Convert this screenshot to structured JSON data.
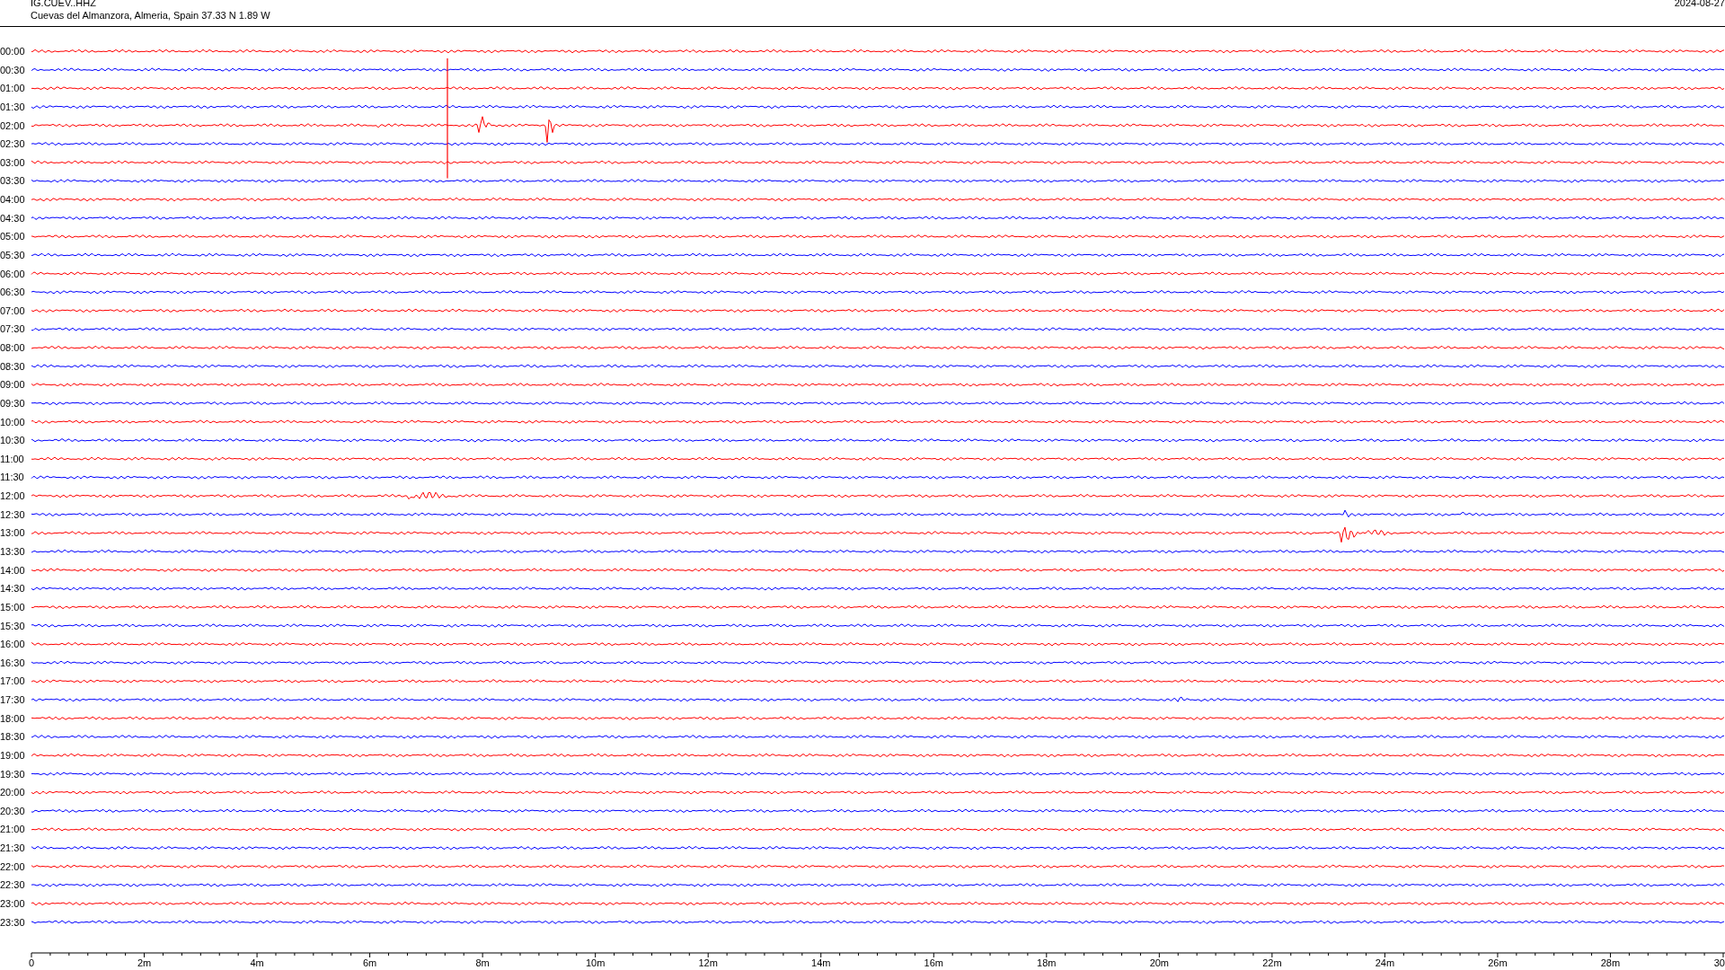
{
  "header": {
    "channel": "IG.CUEV..HHZ",
    "location": "Cuevas del Almanzora, Almeria, Spain  37.33 N 1.89 W",
    "date": "2024-08-27"
  },
  "rows": [
    {
      "time": "00:00",
      "color": "#ff0000"
    },
    {
      "time": "00:30",
      "color": "#0000ff"
    },
    {
      "time": "01:00",
      "color": "#ff0000"
    },
    {
      "time": "01:30",
      "color": "#0000ff"
    },
    {
      "time": "02:00",
      "color": "#ff0000"
    },
    {
      "time": "02:30",
      "color": "#0000ff"
    },
    {
      "time": "03:00",
      "color": "#ff0000"
    },
    {
      "time": "03:30",
      "color": "#0000ff"
    },
    {
      "time": "04:00",
      "color": "#ff0000"
    },
    {
      "time": "04:30",
      "color": "#0000ff"
    },
    {
      "time": "05:00",
      "color": "#ff0000"
    },
    {
      "time": "05:30",
      "color": "#0000ff"
    },
    {
      "time": "06:00",
      "color": "#ff0000"
    },
    {
      "time": "06:30",
      "color": "#0000ff"
    },
    {
      "time": "07:00",
      "color": "#ff0000"
    },
    {
      "time": "07:30",
      "color": "#0000ff"
    },
    {
      "time": "08:00",
      "color": "#ff0000"
    },
    {
      "time": "08:30",
      "color": "#0000ff"
    },
    {
      "time": "09:00",
      "color": "#ff0000"
    },
    {
      "time": "09:30",
      "color": "#0000ff"
    },
    {
      "time": "10:00",
      "color": "#ff0000"
    },
    {
      "time": "10:30",
      "color": "#0000ff"
    },
    {
      "time": "11:00",
      "color": "#ff0000"
    },
    {
      "time": "11:30",
      "color": "#0000ff"
    },
    {
      "time": "12:00",
      "color": "#ff0000"
    },
    {
      "time": "12:30",
      "color": "#0000ff"
    },
    {
      "time": "13:00",
      "color": "#ff0000"
    },
    {
      "time": "13:30",
      "color": "#0000ff"
    },
    {
      "time": "14:00",
      "color": "#ff0000"
    },
    {
      "time": "14:30",
      "color": "#0000ff"
    },
    {
      "time": "15:00",
      "color": "#ff0000"
    },
    {
      "time": "15:30",
      "color": "#0000ff"
    },
    {
      "time": "16:00",
      "color": "#ff0000"
    },
    {
      "time": "16:30",
      "color": "#0000ff"
    },
    {
      "time": "17:00",
      "color": "#ff0000"
    },
    {
      "time": "17:30",
      "color": "#0000ff"
    },
    {
      "time": "18:00",
      "color": "#ff0000"
    },
    {
      "time": "18:30",
      "color": "#0000ff"
    },
    {
      "time": "19:00",
      "color": "#ff0000"
    },
    {
      "time": "19:30",
      "color": "#0000ff"
    },
    {
      "time": "20:00",
      "color": "#ff0000"
    },
    {
      "time": "20:30",
      "color": "#0000ff"
    },
    {
      "time": "21:00",
      "color": "#ff0000"
    },
    {
      "time": "21:30",
      "color": "#0000ff"
    },
    {
      "time": "22:00",
      "color": "#ff0000"
    },
    {
      "time": "22:30",
      "color": "#0000ff"
    },
    {
      "time": "23:00",
      "color": "#ff0000"
    },
    {
      "time": "23:30",
      "color": "#0000ff"
    }
  ],
  "axis": {
    "labels": [
      "0",
      "2m",
      "4m",
      "6m",
      "8m",
      "10m",
      "12m",
      "14m",
      "16m",
      "18m",
      "20m",
      "22m",
      "24m",
      "26m",
      "28m",
      "30"
    ]
  }
}
